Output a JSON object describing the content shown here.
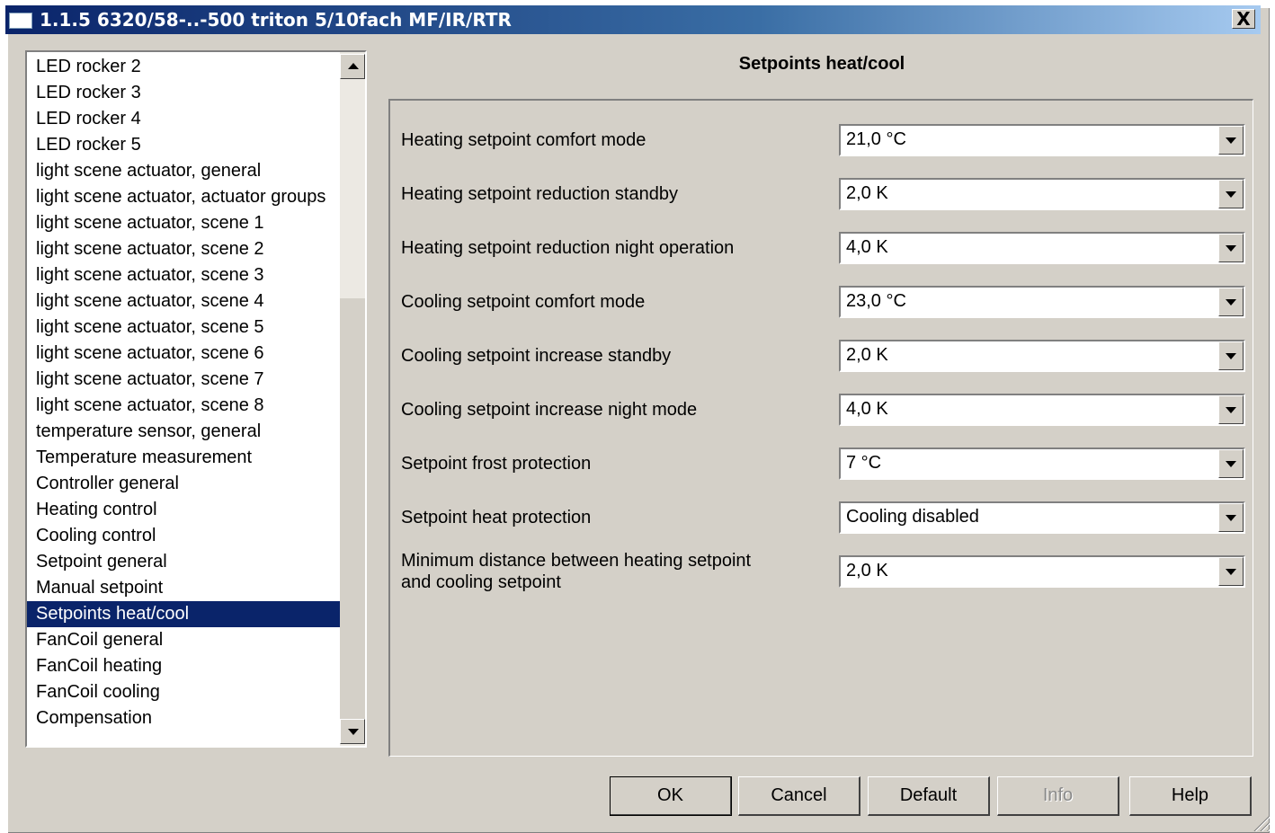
{
  "window": {
    "title": "1.1.5 6320/58-..-500 triton 5/10fach MF/IR/RTR",
    "close_label": "X"
  },
  "tree": {
    "items": [
      {
        "label": "LED rocker 2"
      },
      {
        "label": "LED rocker 3"
      },
      {
        "label": "LED rocker 4"
      },
      {
        "label": "LED rocker 5"
      },
      {
        "label": "light scene actuator, general"
      },
      {
        "label": "light scene actuator, actuator groups"
      },
      {
        "label": "light scene actuator, scene 1"
      },
      {
        "label": "light scene actuator, scene 2"
      },
      {
        "label": "light scene actuator, scene 3"
      },
      {
        "label": "light scene actuator, scene 4"
      },
      {
        "label": "light scene actuator, scene 5"
      },
      {
        "label": "light scene actuator, scene 6"
      },
      {
        "label": "light scene actuator, scene 7"
      },
      {
        "label": "light scene actuator, scene 8"
      },
      {
        "label": "temperature sensor, general"
      },
      {
        "label": "Temperature measurement"
      },
      {
        "label": "Controller general"
      },
      {
        "label": "Heating control"
      },
      {
        "label": "Cooling control"
      },
      {
        "label": "Setpoint general"
      },
      {
        "label": "Manual setpoint"
      },
      {
        "label": "Setpoints heat/cool",
        "selected": true
      },
      {
        "label": "FanCoil general"
      },
      {
        "label": "FanCoil heating"
      },
      {
        "label": "FanCoil cooling"
      },
      {
        "label": "Compensation"
      }
    ],
    "selected_index": 21
  },
  "page": {
    "heading": "Setpoints heat/cool",
    "params": [
      {
        "label": "Heating setpoint comfort mode",
        "value": "21,0 °C"
      },
      {
        "label": "Heating setpoint reduction standby",
        "value": "2,0 K"
      },
      {
        "label": "Heating setpoint reduction night operation",
        "value": "4,0 K"
      },
      {
        "label": "Cooling setpoint comfort mode",
        "value": "23,0 °C"
      },
      {
        "label": "Cooling setpoint increase standby",
        "value": "2,0 K"
      },
      {
        "label": "Cooling setpoint increase night mode",
        "value": "4,0 K"
      },
      {
        "label": "Setpoint frost protection",
        "value": "7 °C"
      },
      {
        "label": "Setpoint heat protection",
        "value": "Cooling disabled"
      },
      {
        "label_line1": "Minimum distance between heating setpoint",
        "label_line2": "and cooling setpoint",
        "value": "2,0 K"
      }
    ]
  },
  "buttons": {
    "ok": "OK",
    "cancel": "Cancel",
    "default": "Default",
    "info": "Info",
    "help": "Help"
  },
  "colors": {
    "selection": "#0a246a",
    "dialog_bg": "#d4d0c8",
    "title_gradient_start": "#0a246a",
    "title_gradient_end": "#a6caf0"
  }
}
